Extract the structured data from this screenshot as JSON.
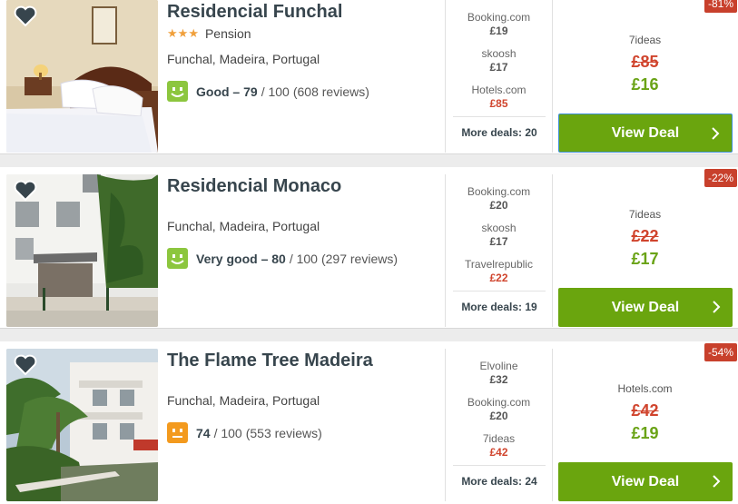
{
  "hotels": [
    {
      "name": "Residencial Funchal",
      "stars": 3,
      "property_type": "Pension",
      "location": "Funchal, Madeira, Portugal",
      "rating": {
        "label": "Good –",
        "score": "79",
        "out_of": "/ 100",
        "reviews": "(608 reviews)",
        "face": "smiley-green"
      },
      "deals": [
        {
          "provider": "Booking.com",
          "price": "£19",
          "highlight": false
        },
        {
          "provider": "skoosh",
          "price": "£17",
          "highlight": false
        },
        {
          "provider": "Hotels.com",
          "price": "£85",
          "highlight": true
        }
      ],
      "more_deals": "More deals: 20",
      "discount": "-81%",
      "best_provider": "7ideas",
      "old_price": "£85",
      "new_price": "£16",
      "cta": "View Deal"
    },
    {
      "name": "Residencial Monaco",
      "stars": 0,
      "property_type": "",
      "location": "Funchal, Madeira, Portugal",
      "rating": {
        "label": "Very good –",
        "score": "80",
        "out_of": "/ 100",
        "reviews": "(297 reviews)",
        "face": "smiley-green"
      },
      "deals": [
        {
          "provider": "Booking.com",
          "price": "£20",
          "highlight": false
        },
        {
          "provider": "skoosh",
          "price": "£17",
          "highlight": false
        },
        {
          "provider": "Travelrepublic",
          "price": "£22",
          "highlight": true
        }
      ],
      "more_deals": "More deals: 19",
      "discount": "-22%",
      "best_provider": "7ideas",
      "old_price": "£22",
      "new_price": "£17",
      "cta": "View Deal"
    },
    {
      "name": "The Flame Tree Madeira",
      "stars": 0,
      "property_type": "",
      "location": "Funchal, Madeira, Portugal",
      "rating": {
        "label": "",
        "score": "74",
        "out_of": "/ 100",
        "reviews": "(553 reviews)",
        "face": "neutral-orange"
      },
      "deals": [
        {
          "provider": "Elvoline",
          "price": "£32",
          "highlight": false
        },
        {
          "provider": "Booking.com",
          "price": "£20",
          "highlight": false
        },
        {
          "provider": "7ideas",
          "price": "£42",
          "highlight": true
        }
      ],
      "more_deals": "More deals: 24",
      "discount": "-54%",
      "best_provider": "Hotels.com",
      "old_price": "£42",
      "new_price": "£19",
      "cta": "View Deal"
    }
  ],
  "icons": {
    "favorite": "heart-icon",
    "chevron": "chevron-right-icon",
    "star": "star-icon"
  },
  "colors": {
    "cta_green": "#6aa50e",
    "price_red": "#d0442d",
    "price_green": "#6aa316",
    "discount_bg": "#c8402c",
    "good_face": "#8cc63e",
    "neutral_face": "#f39a1e",
    "star": "#f0a03c"
  }
}
